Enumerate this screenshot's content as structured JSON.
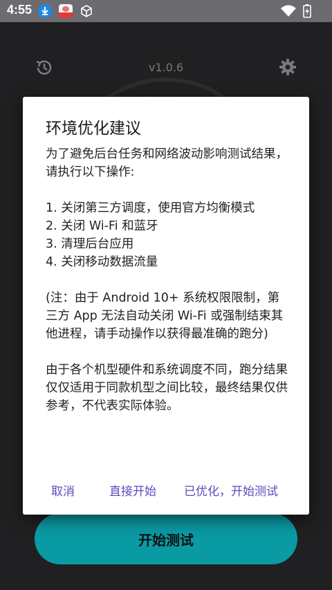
{
  "status_bar": {
    "time": "4:55",
    "icons": [
      "download-icon",
      "app-notification-icon",
      "cube-icon",
      "wifi-icon",
      "battery-charging-icon"
    ]
  },
  "app": {
    "version": "v1.0.6",
    "score_label": "能效得分",
    "start_button_label": "开始测试"
  },
  "dialog": {
    "title": "环境优化建议",
    "intro": "为了避免后台任务和网络波动影响测试结果，请执行以下操作:",
    "steps": [
      "1. 关闭第三方调度，使用官方均衡模式",
      "2. 关闭 Wi-Fi 和蓝牙",
      "3. 清理后台应用",
      "4. 关闭移动数据流量"
    ],
    "note": "(注：由于 Android 10+ 系统权限限制，第三方 App 无法自动关闭 Wi-Fi 或强制结束其他进程，请手动操作以获得最准确的跑分)",
    "disclaimer": "由于各个机型硬件和系统调度不同，跑分结果仅仅适用于同款机型之间比较，最终结果仅供参考，不代表实际体验。",
    "buttons": {
      "cancel": "取消",
      "direct_start": "直接开始",
      "optimized_start": "已优化，开始测试"
    }
  },
  "colors": {
    "accent_button": "#0a9aa4",
    "dialog_button_text": "#5a4bbf",
    "status_bar_bg": "#6b6b70"
  }
}
